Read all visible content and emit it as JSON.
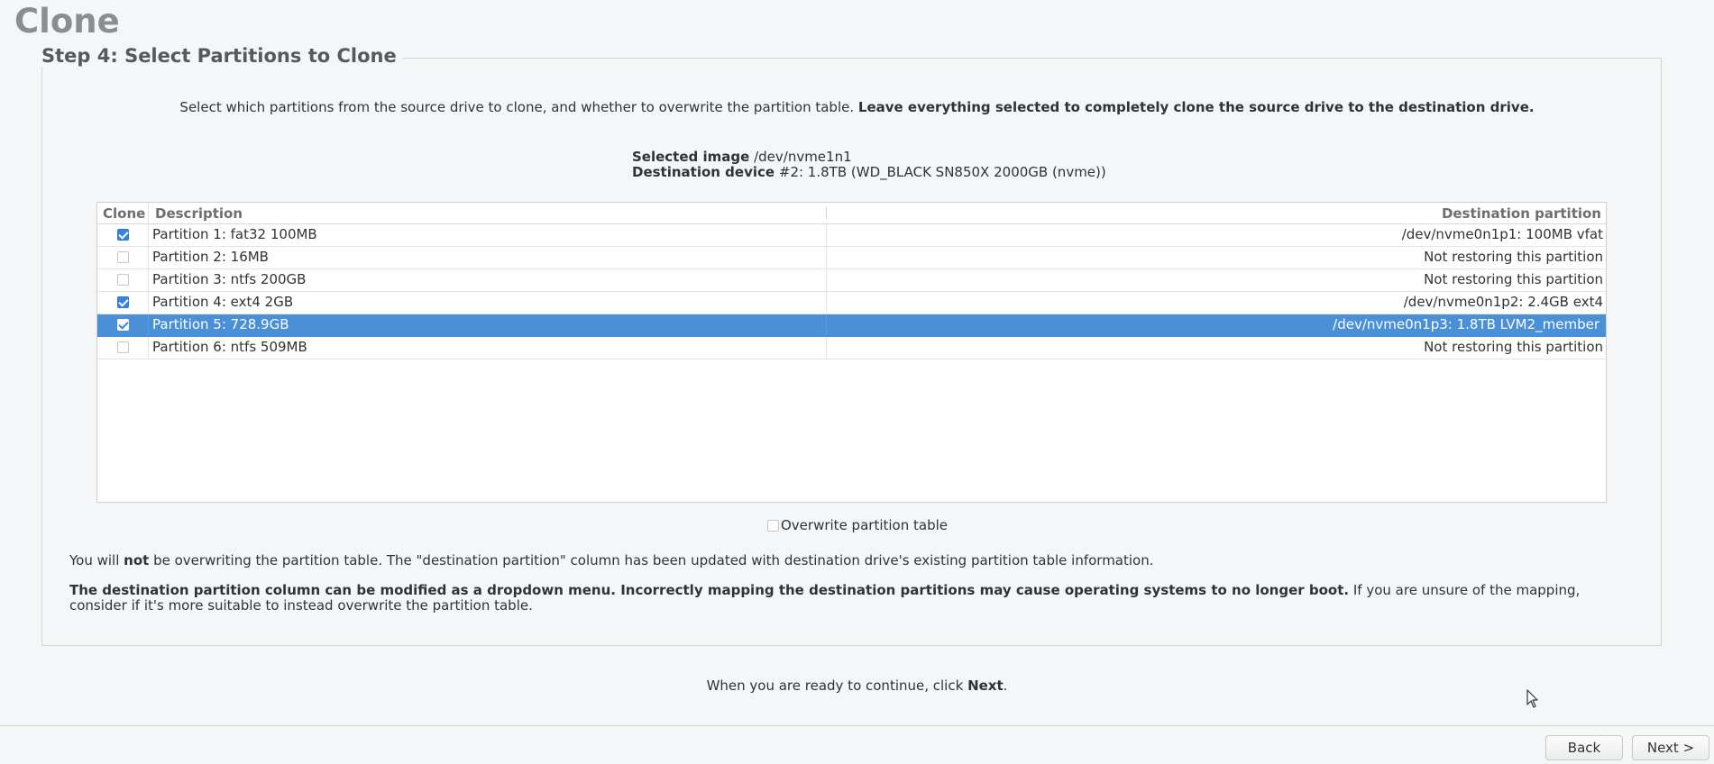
{
  "app": {
    "title": "Clone"
  },
  "step": {
    "title": "Step 4: Select Partitions to Clone"
  },
  "intro": {
    "text": "Select which partitions from the source drive to clone, and whether to overwrite the partition table.",
    "bold": "Leave everything selected to completely clone the source drive to the destination drive."
  },
  "selected_image": {
    "label": "Selected image",
    "value": "/dev/nvme1n1"
  },
  "destination_device": {
    "label": "Destination device",
    "value": "#2: 1.8TB (WD_BLACK SN850X 2000GB (nvme))"
  },
  "table": {
    "headers": {
      "clone": "Clone",
      "description": "Description",
      "destination": "Destination partition"
    },
    "rows": [
      {
        "checked": true,
        "description": "Partition 1: fat32 100MB",
        "destination": "/dev/nvme0n1p1: 100MB vfat"
      },
      {
        "checked": false,
        "description": "Partition 2: 16MB",
        "destination": "Not restoring this partition"
      },
      {
        "checked": false,
        "description": "Partition 3: ntfs 200GB",
        "destination": "Not restoring this partition"
      },
      {
        "checked": true,
        "description": "Partition 4: ext4 2GB",
        "destination": "/dev/nvme0n1p2: 2.4GB ext4"
      },
      {
        "checked": true,
        "description": "Partition 5: 728.9GB",
        "destination": "/dev/nvme0n1p3: 1.8TB LVM2_member",
        "selected": true
      },
      {
        "checked": false,
        "description": "Partition 6: ntfs 509MB",
        "destination": "Not restoring this partition"
      }
    ]
  },
  "overwrite": {
    "label": "Overwrite partition table",
    "checked": false
  },
  "note1": {
    "part1": "You will ",
    "bold": "not",
    "part2": " be overwriting the partition table. The \"destination partition\" column has been updated with destination drive's existing partition table information."
  },
  "note2": {
    "bold": "The destination partition column can be modified as a dropdown menu. Incorrectly mapping the destination partitions may cause operating systems to no longer boot.",
    "text": " If you are unsure of the mapping, consider if it's more suitable to instead overwrite the partition table."
  },
  "continue": {
    "text": "When you are ready to continue, click ",
    "bold": "Next",
    "end": "."
  },
  "buttons": {
    "back": "Back",
    "next": "Next >"
  },
  "icons": {
    "cursor": "mouse-pointer-icon",
    "check": "checkmark-icon"
  },
  "colors": {
    "selection": "#4a90d9",
    "check": "#3584e4",
    "title": "#8b8e8f"
  }
}
